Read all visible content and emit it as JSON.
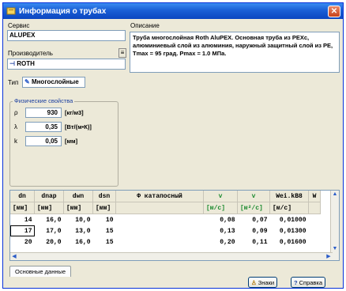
{
  "window": {
    "title": "Информация о трубах",
    "close_glyph": "✕"
  },
  "left": {
    "label_search": "Сервис",
    "search_value": "ALUPEX",
    "label_manufacturer": "Производитель",
    "manufacturer_value": "ROTH",
    "mini_button": "≡",
    "label_type": "Тип",
    "type_value": "Многослойные"
  },
  "description": {
    "label": "Описание",
    "text": "Труба многослойная Roth AluPEX. Основная труба из PEXc, алюминиевый слой из алюминия, наружный защитный слой из PE, Tmax = 95 град. Pmax = 1.0 МПа."
  },
  "physical": {
    "title": "Физические свойства",
    "rows": [
      {
        "symbol": "ρ",
        "value": "930",
        "unit": "[кг/м3]"
      },
      {
        "symbol": "λ",
        "value": "0,35",
        "unit": "[Вт/(м•К)]"
      },
      {
        "symbol": "k",
        "value": "0,05",
        "unit": "[мм]"
      }
    ]
  },
  "table": {
    "headers": [
      "dn",
      "dnap",
      "dwn",
      "dsn",
      "Ф катапосный",
      "v",
      "v",
      "Wei.kB8",
      "W"
    ],
    "units": [
      "[мм]",
      "[мм]",
      "[мм]",
      "[мм]",
      "",
      "[м/с]",
      "[м²/с]",
      "[м/с]",
      ""
    ],
    "rows": [
      [
        "14",
        "16,0",
        "10,0",
        "10",
        "",
        "0,08",
        "0,07",
        "0,01000",
        ""
      ],
      [
        "17",
        "17,0",
        "13,0",
        "15",
        "",
        "0,13",
        "0,09",
        "0,01300",
        ""
      ],
      [
        "20",
        "20,0",
        "16,0",
        "15",
        "",
        "0,20",
        "0,11",
        "0,01600",
        ""
      ]
    ]
  },
  "tabs": [
    "Основные данные"
  ],
  "buttons": {
    "help": "Знаки",
    "help_glyph": "?",
    "info": "Справка",
    "info_glyph": "?"
  },
  "colors": {
    "title_bar": "#0b46c0",
    "accent_green": "#1a8a2e",
    "close": "#c8431a"
  }
}
